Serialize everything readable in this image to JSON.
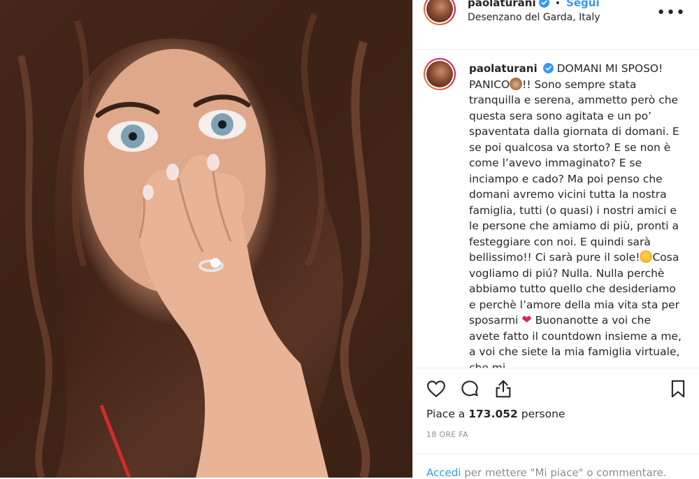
{
  "post": {
    "username": "paolaturani",
    "follow_label": "Segui",
    "separator": "•",
    "location": "Desenzano del Garda, Italy",
    "more_icon": "more-options-icon",
    "photo_description_icon": "photo",
    "caption": {
      "p1": "DOMANI MI SPOSO! PANICO",
      "p2": "!! Sono sempre stata tranquilla e serena, ammetto però che questa sera sono agitata e un po’ spaventata dalla giornata di domani. E se poi qualcosa va storto? E se non è come l’avevo immaginato? E se inciampo e cado? Ma poi penso che domani avremo vicini tutta la nostra famiglia, tutti (o quasi) i nostri amici e le persone che amiamo di più, pronti a festeggiare con noi. E quindi sarà bellissimo!! Ci sarà pure il sole!",
      "p3": "Cosa vogliamo di piú? Nulla. Nulla perchè abbiamo tutto quello che desideriamo e perchè l’amore della mia vita sta per sposarmi",
      "p4": "Buonanotte a voi che avete fatto il countdown insieme a me, a voi che siete la mia famiglia virtuale, che mi"
    },
    "likes_prefix": "Piace a",
    "likes_count": "173.052",
    "likes_suffix": "persone",
    "time_ago": "18 ORE FA",
    "login_link": "Accedi",
    "login_rest": "per mettere \"Mi piace\" o commentare."
  },
  "colors": {
    "accent": "#3897f0",
    "text": "#262626",
    "muted": "#8e8e8e",
    "heart": "#e0245e"
  }
}
